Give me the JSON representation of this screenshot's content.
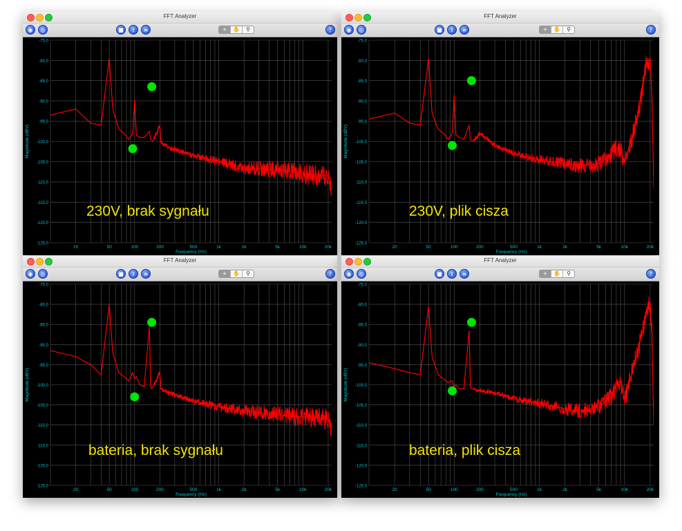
{
  "windows": [
    {
      "title": "FFT Analyzer",
      "label": "230V, brak sygnału"
    },
    {
      "title": "FFT Analyzer",
      "label": "230V, plik cisza"
    },
    {
      "title": "FFT Analyzer",
      "label": "bateria, brak sygnału"
    },
    {
      "title": "FFT Analyzer",
      "label": "bateria, plik cisza"
    }
  ],
  "icons": {
    "toolbar_left": [
      "globe-icon",
      "network-icon"
    ],
    "toolbar_mid": [
      "stop-icon",
      "export-icon",
      "settings-icon"
    ],
    "toolbar_right": [
      "help-icon"
    ],
    "tools": [
      "crosshair-tool-icon",
      "pan-hand-icon",
      "zoom-magnifier-icon"
    ]
  },
  "colors": {
    "trace": "#ff0000",
    "marker": "#00e600",
    "axis_text": "#00c8d4",
    "label": "#f4e400",
    "grid": "#555555"
  },
  "chart_data": [
    {
      "type": "line",
      "xlabel": "Frequency (Hz)",
      "ylabel": "Magnitude (dBV)",
      "x_scale": "log",
      "xlim": [
        10,
        22000
      ],
      "ylim": [
        -125,
        -75
      ],
      "y_ticks": [
        "-75.0",
        "-80.0",
        "-85.0",
        "-90.0",
        "-95.0",
        "-100.0",
        "-105.0",
        "-110.0",
        "-115.0",
        "-120.0",
        "-125.0"
      ],
      "x_ticks": [
        "20",
        "50",
        "100",
        "200",
        "500",
        "1k",
        "2k",
        "5k",
        "10k",
        "20k"
      ],
      "grid": true,
      "series": [
        {
          "x": [
            10,
            20,
            30,
            40,
            50,
            55,
            65,
            75,
            85,
            95,
            100,
            105,
            115,
            130,
            150,
            155,
            165,
            200,
            205,
            220,
            300,
            500,
            1000,
            2000,
            5000,
            10000,
            20000,
            22000
          ],
          "y": [
            -93.5,
            -92,
            -95.5,
            -96,
            -79.5,
            -92,
            -97,
            -98,
            -99.5,
            -98,
            -89.5,
            -98.5,
            -99,
            -99,
            -97.5,
            -99.5,
            -100,
            -96,
            -100,
            -101,
            -102,
            -103.5,
            -105,
            -106.5,
            -107,
            -108,
            -108.5,
            -112
          ]
        }
      ],
      "markers": [
        {
          "x": 160,
          "y": -86.5
        },
        {
          "x": 95,
          "y": -101.8
        }
      ]
    },
    {
      "type": "line",
      "xlabel": "Frequency (Hz)",
      "ylabel": "Magnitude (dBV)",
      "x_scale": "log",
      "xlim": [
        10,
        22000
      ],
      "ylim": [
        -125,
        -75
      ],
      "y_ticks": [
        "-75.0",
        "-80.0",
        "-85.0",
        "-90.0",
        "-95.0",
        "-100.0",
        "-105.0",
        "-110.0",
        "-115.0",
        "-120.0",
        "-125.0"
      ],
      "x_ticks": [
        "20",
        "50",
        "100",
        "200",
        "500",
        "1k",
        "2k",
        "5k",
        "10k",
        "20k"
      ],
      "grid": true,
      "series": [
        {
          "x": [
            10,
            20,
            30,
            40,
            50,
            55,
            65,
            75,
            85,
            95,
            100,
            105,
            115,
            130,
            150,
            155,
            165,
            200,
            300,
            500,
            1000,
            2000,
            3000,
            5000,
            7000,
            8000,
            9000,
            10000,
            15000,
            18000,
            20000,
            21000,
            22000
          ],
          "y": [
            -94.5,
            -93,
            -95.5,
            -96,
            -79.5,
            -93,
            -97,
            -98,
            -99.5,
            -98,
            -88.5,
            -98.5,
            -99,
            -99.5,
            -96,
            -99.5,
            -100,
            -98,
            -101,
            -103,
            -104.5,
            -105.5,
            -106,
            -105.5,
            -103,
            -101.5,
            -102,
            -105.5,
            -92,
            -81,
            -79.5,
            -90,
            -110
          ]
        }
      ],
      "markers": [
        {
          "x": 160,
          "y": -85
        },
        {
          "x": 95,
          "y": -101
        }
      ]
    },
    {
      "type": "line",
      "xlabel": "Frequency (Hz)",
      "ylabel": "Magnitude (dBV)",
      "x_scale": "log",
      "xlim": [
        10,
        22000
      ],
      "ylim": [
        -125,
        -75
      ],
      "y_ticks": [
        "-75.0",
        "-80.0",
        "-85.0",
        "-90.0",
        "-95.0",
        "-100.0",
        "-105.0",
        "-110.0",
        "-115.0",
        "-120.0",
        "-125.0"
      ],
      "x_ticks": [
        "20",
        "50",
        "100",
        "200",
        "500",
        "1k",
        "2k",
        "5k",
        "10k",
        "20k"
      ],
      "grid": true,
      "series": [
        {
          "x": [
            10,
            20,
            30,
            40,
            50,
            55,
            65,
            75,
            85,
            95,
            100,
            105,
            115,
            130,
            150,
            155,
            160,
            200,
            205,
            220,
            300,
            500,
            1000,
            2000,
            5000,
            10000,
            20000,
            22000
          ],
          "y": [
            -91.5,
            -93,
            -95,
            -97.5,
            -80,
            -92,
            -97,
            -98,
            -99,
            -97,
            -98.5,
            -98,
            -100,
            -100.5,
            -85.5,
            -100.5,
            -101,
            -97,
            -101,
            -101.5,
            -102.5,
            -104,
            -105.5,
            -106.5,
            -107.5,
            -108,
            -108.5,
            -111
          ]
        }
      ],
      "markers": [
        {
          "x": 160,
          "y": -84.5
        },
        {
          "x": 100,
          "y": -103
        }
      ]
    },
    {
      "type": "line",
      "xlabel": "Frequency (Hz)",
      "ylabel": "Magnitude (dBV)",
      "x_scale": "log",
      "xlim": [
        10,
        22000
      ],
      "ylim": [
        -125,
        -75
      ],
      "y_ticks": [
        "-75.0",
        "-80.0",
        "-85.0",
        "-90.0",
        "-95.0",
        "-100.0",
        "-105.0",
        "-110.0",
        "-115.0",
        "-120.0",
        "-125.0"
      ],
      "x_ticks": [
        "20",
        "50",
        "100",
        "200",
        "500",
        "1k",
        "2k",
        "5k",
        "10k",
        "20k"
      ],
      "grid": true,
      "series": [
        {
          "x": [
            10,
            20,
            30,
            40,
            50,
            55,
            65,
            75,
            85,
            95,
            100,
            105,
            115,
            130,
            150,
            155,
            160,
            200,
            300,
            500,
            1000,
            2000,
            3000,
            5000,
            7000,
            8000,
            9000,
            10000,
            15000,
            18000,
            20000,
            21000,
            22000
          ],
          "y": [
            -94.5,
            -96,
            -97,
            -97.5,
            -80.5,
            -93,
            -97.5,
            -98.5,
            -99.5,
            -99,
            -100.5,
            -100,
            -101,
            -101,
            -86.5,
            -100.5,
            -101,
            -101.5,
            -102,
            -103.5,
            -104.5,
            -106,
            -106.5,
            -105.5,
            -103,
            -100,
            -99,
            -104,
            -90,
            -81.5,
            -79.5,
            -88,
            -110
          ]
        }
      ],
      "markers": [
        {
          "x": 160,
          "y": -84.5
        },
        {
          "x": 95,
          "y": -101.5
        }
      ]
    }
  ]
}
